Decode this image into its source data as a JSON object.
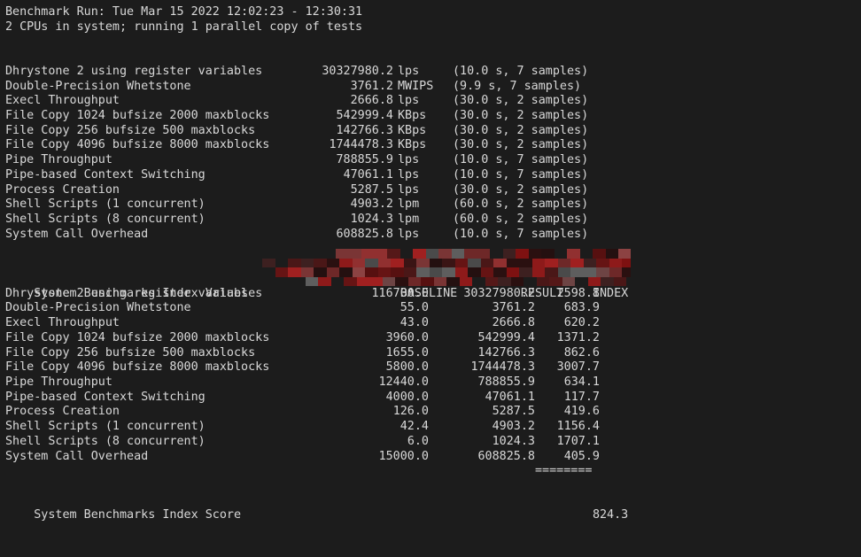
{
  "header": {
    "line1": "Benchmark Run: Tue Mar 15 2022 12:02:23 - 12:30:31",
    "line2": "2 CPUs in system; running 1 parallel copy of tests"
  },
  "results": {
    "rows": [
      {
        "name": "Dhrystone 2 using register variables",
        "value": "30327980.2",
        "unit": "lps",
        "timing": "(10.0 s, 7 samples)"
      },
      {
        "name": "Double-Precision Whetstone",
        "value": "3761.2",
        "unit": "MWIPS",
        "timing": "(9.9 s, 7 samples)"
      },
      {
        "name": "Execl Throughput",
        "value": "2666.8",
        "unit": "lps",
        "timing": "(30.0 s, 2 samples)"
      },
      {
        "name": "File Copy 1024 bufsize 2000 maxblocks",
        "value": "542999.4",
        "unit": "KBps",
        "timing": "(30.0 s, 2 samples)"
      },
      {
        "name": "File Copy 256 bufsize 500 maxblocks",
        "value": "142766.3",
        "unit": "KBps",
        "timing": "(30.0 s, 2 samples)"
      },
      {
        "name": "File Copy 4096 bufsize 8000 maxblocks",
        "value": "1744478.3",
        "unit": "KBps",
        "timing": "(30.0 s, 2 samples)"
      },
      {
        "name": "Pipe Throughput",
        "value": "788855.9",
        "unit": "lps",
        "timing": "(10.0 s, 7 samples)"
      },
      {
        "name": "Pipe-based Context Switching",
        "value": "47061.1",
        "unit": "lps",
        "timing": "(10.0 s, 7 samples)"
      },
      {
        "name": "Process Creation",
        "value": "5287.5",
        "unit": "lps",
        "timing": "(30.0 s, 2 samples)"
      },
      {
        "name": "Shell Scripts (1 concurrent)",
        "value": "4903.2",
        "unit": "lpm",
        "timing": "(60.0 s, 2 samples)"
      },
      {
        "name": "Shell Scripts (8 concurrent)",
        "value": "1024.3",
        "unit": "lpm",
        "timing": "(60.0 s, 2 samples)"
      },
      {
        "name": "System Call Overhead",
        "value": "608825.8",
        "unit": "lps",
        "timing": "(10.0 s, 7 samples)"
      }
    ]
  },
  "index_table": {
    "header": {
      "title": "System Benchmarks Index Values",
      "baseline": "BASELINE",
      "result": "RESULT",
      "index": "INDEX"
    },
    "rows": [
      {
        "name": "Dhrystone 2 using register variables",
        "baseline": "116700.0",
        "result": "30327980.2",
        "index": "2598.8"
      },
      {
        "name": "Double-Precision Whetstone",
        "baseline": "55.0",
        "result": "3761.2",
        "index": "683.9"
      },
      {
        "name": "Execl Throughput",
        "baseline": "43.0",
        "result": "2666.8",
        "index": "620.2"
      },
      {
        "name": "File Copy 1024 bufsize 2000 maxblocks",
        "baseline": "3960.0",
        "result": "542999.4",
        "index": "1371.2"
      },
      {
        "name": "File Copy 256 bufsize 500 maxblocks",
        "baseline": "1655.0",
        "result": "142766.3",
        "index": "862.6"
      },
      {
        "name": "File Copy 4096 bufsize 8000 maxblocks",
        "baseline": "5800.0",
        "result": "1744478.3",
        "index": "3007.7"
      },
      {
        "name": "Pipe Throughput",
        "baseline": "12440.0",
        "result": "788855.9",
        "index": "634.1"
      },
      {
        "name": "Pipe-based Context Switching",
        "baseline": "4000.0",
        "result": "47061.1",
        "index": "117.7"
      },
      {
        "name": "Process Creation",
        "baseline": "126.0",
        "result": "5287.5",
        "index": "419.6"
      },
      {
        "name": "Shell Scripts (1 concurrent)",
        "baseline": "42.4",
        "result": "4903.2",
        "index": "1156.4"
      },
      {
        "name": "Shell Scripts (8 concurrent)",
        "baseline": "6.0",
        "result": "1024.3",
        "index": "1707.1"
      },
      {
        "name": "System Call Overhead",
        "baseline": "15000.0",
        "result": "608825.8",
        "index": "405.9"
      }
    ],
    "separator": "========",
    "score_label": "System Benchmarks Index Score",
    "score_value": "824.3"
  },
  "colors": {
    "background": "#1c1c1c",
    "text": "#d8d8d8",
    "redaction": "#7e1111"
  },
  "redaction": {
    "label": "redacted-region",
    "note": "pixelated red mosaic covering System Call Overhead result line and INDEX column header"
  }
}
